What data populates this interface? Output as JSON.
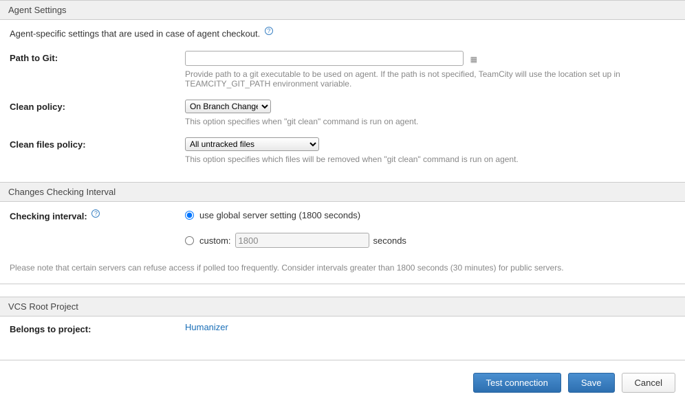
{
  "sections": {
    "agent": {
      "header": "Agent Settings",
      "desc": "Agent-specific settings that are used in case of agent checkout."
    },
    "interval": {
      "header": "Changes Checking Interval"
    },
    "project": {
      "header": "VCS Root Project"
    }
  },
  "pathToGit": {
    "label": "Path to Git:",
    "value": "",
    "hint": "Provide path to a git executable to be used on agent. If the path is not specified, TeamCity will use the location set up in TEAMCITY_GIT_PATH environment variable."
  },
  "cleanPolicy": {
    "label": "Clean policy:",
    "selected": "On Branch Change",
    "hint": "This option specifies when \"git clean\" command is run on agent."
  },
  "cleanFilesPolicy": {
    "label": "Clean files policy:",
    "selected": "All untracked files",
    "hint": "This option specifies which files will be removed when \"git clean\" command is run on agent."
  },
  "checkingInterval": {
    "label": "Checking interval:",
    "globalLabel": "use global server setting (1800 seconds)",
    "customLabel": "custom:",
    "customValue": "1800",
    "unitLabel": "seconds",
    "note": "Please note that certain servers can refuse access if polled too frequently. Consider intervals greater than 1800 seconds (30 minutes) for public servers."
  },
  "belongsTo": {
    "label": "Belongs to project:",
    "link": "Humanizer"
  },
  "buttons": {
    "testConnection": "Test connection",
    "save": "Save",
    "cancel": "Cancel"
  }
}
